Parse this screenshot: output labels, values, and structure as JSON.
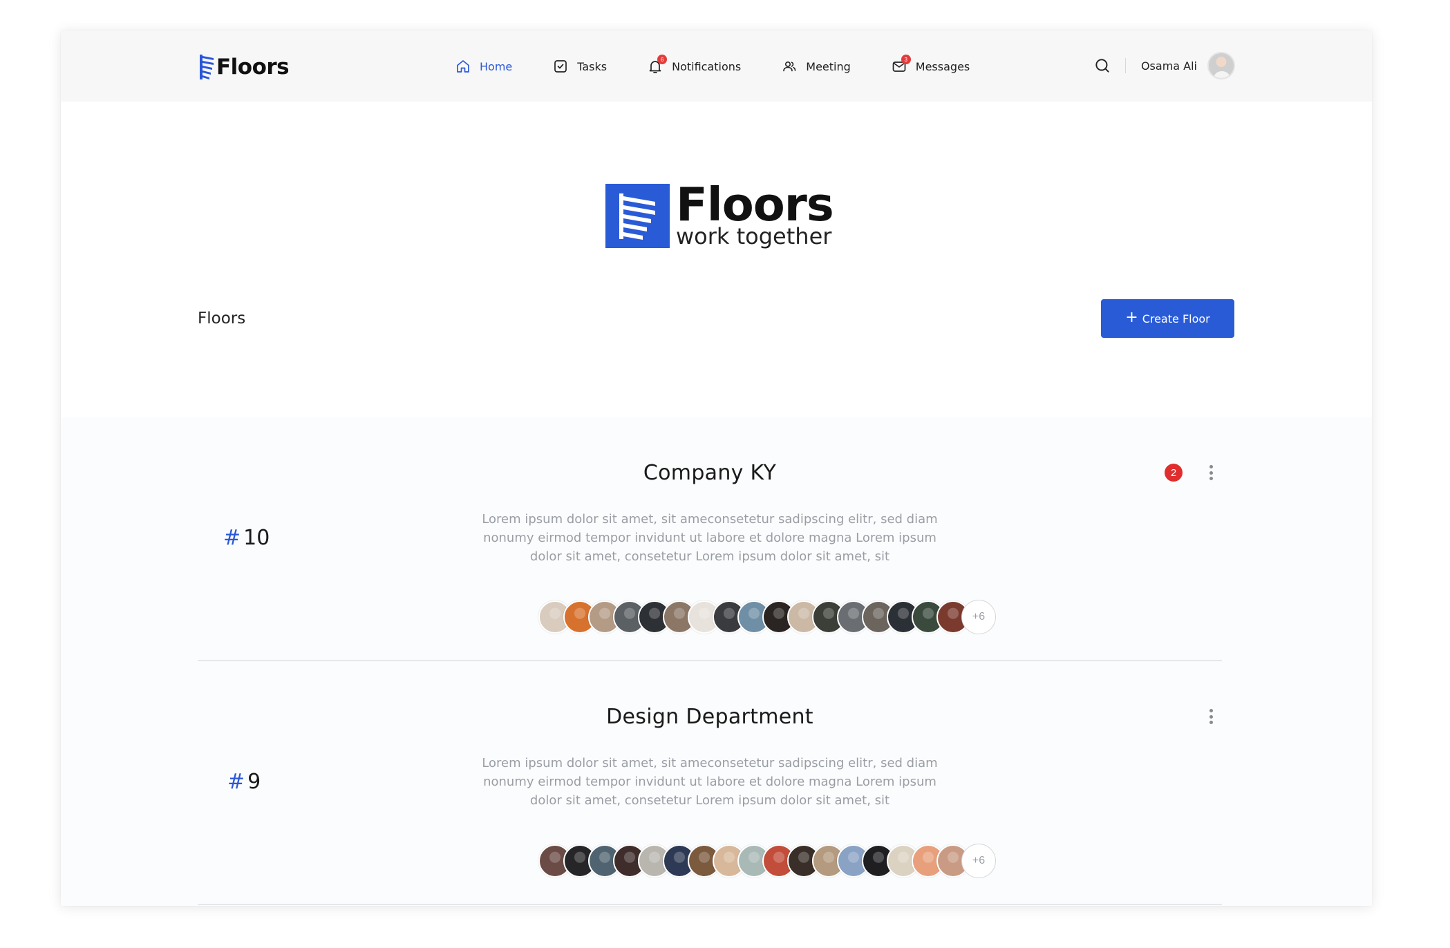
{
  "brand": {
    "name": "Floors"
  },
  "nav": {
    "items": [
      {
        "label": "Home",
        "icon": "home-icon",
        "active": true
      },
      {
        "label": "Tasks",
        "icon": "tasks-icon",
        "active": false
      },
      {
        "label": "Notifications",
        "icon": "bell-icon",
        "active": false,
        "badge": "6"
      },
      {
        "label": "Meeting",
        "icon": "users-icon",
        "active": false
      },
      {
        "label": "Messages",
        "icon": "mail-icon",
        "active": false,
        "badge": "3"
      }
    ]
  },
  "user": {
    "name": "Osama Ali"
  },
  "hero": {
    "title": "Floors",
    "subtitle": "work together"
  },
  "section": {
    "title": "Floors",
    "create_label": "Create Floor",
    "create_icon": "plus-icon"
  },
  "colors": {
    "accent": "#2a5bd7",
    "badge": "#e02e2e",
    "nav_bg": "#f7f7f7",
    "list_bg": "#fbfcfd"
  },
  "floors": [
    {
      "number": "10",
      "hash": "#",
      "title": "Company KY",
      "description": "Lorem ipsum dolor sit amet, sit ameconsetetur sadipscing elitr, sed diam nonumy eirmod  tempor invidunt ut labore et dolore magna Lorem ipsum dolor sit amet, consetetur Lorem ipsum dolor sit amet, sit",
      "unread": "2",
      "more_members": "+6",
      "member_colors": [
        "#d9cbbd",
        "#d7722e",
        "#b49b86",
        "#5b6064",
        "#2d3035",
        "#8c7766",
        "#e7e2dc",
        "#3a3b3e",
        "#6e8fa6",
        "#2a2523",
        "#cbb9a5",
        "#3c3f37",
        "#6a6e72",
        "#6b655e",
        "#2b2f36",
        "#3a4a3c",
        "#7a3a2e"
      ]
    },
    {
      "number": "9",
      "hash": "#",
      "title": "Design Department",
      "description": "Lorem ipsum dolor sit amet, sit ameconsetetur sadipscing elitr, sed diam nonumy eirmod  tempor invidunt ut labore et dolore magna Lorem ipsum dolor sit amet, consetetur Lorem ipsum dolor sit amet, sit",
      "unread": "",
      "more_members": "+6",
      "member_colors": [
        "#6b4b45",
        "#262628",
        "#4f6470",
        "#3e2d2a",
        "#b9b6b0",
        "#2e3a55",
        "#7b5a3e",
        "#d8b89a",
        "#a9b9b6",
        "#c24d3a",
        "#3a2f28",
        "#b49a7e",
        "#8aa2c4",
        "#1f1f22",
        "#dcd2c2",
        "#e8a07c",
        "#c99b84"
      ]
    }
  ]
}
